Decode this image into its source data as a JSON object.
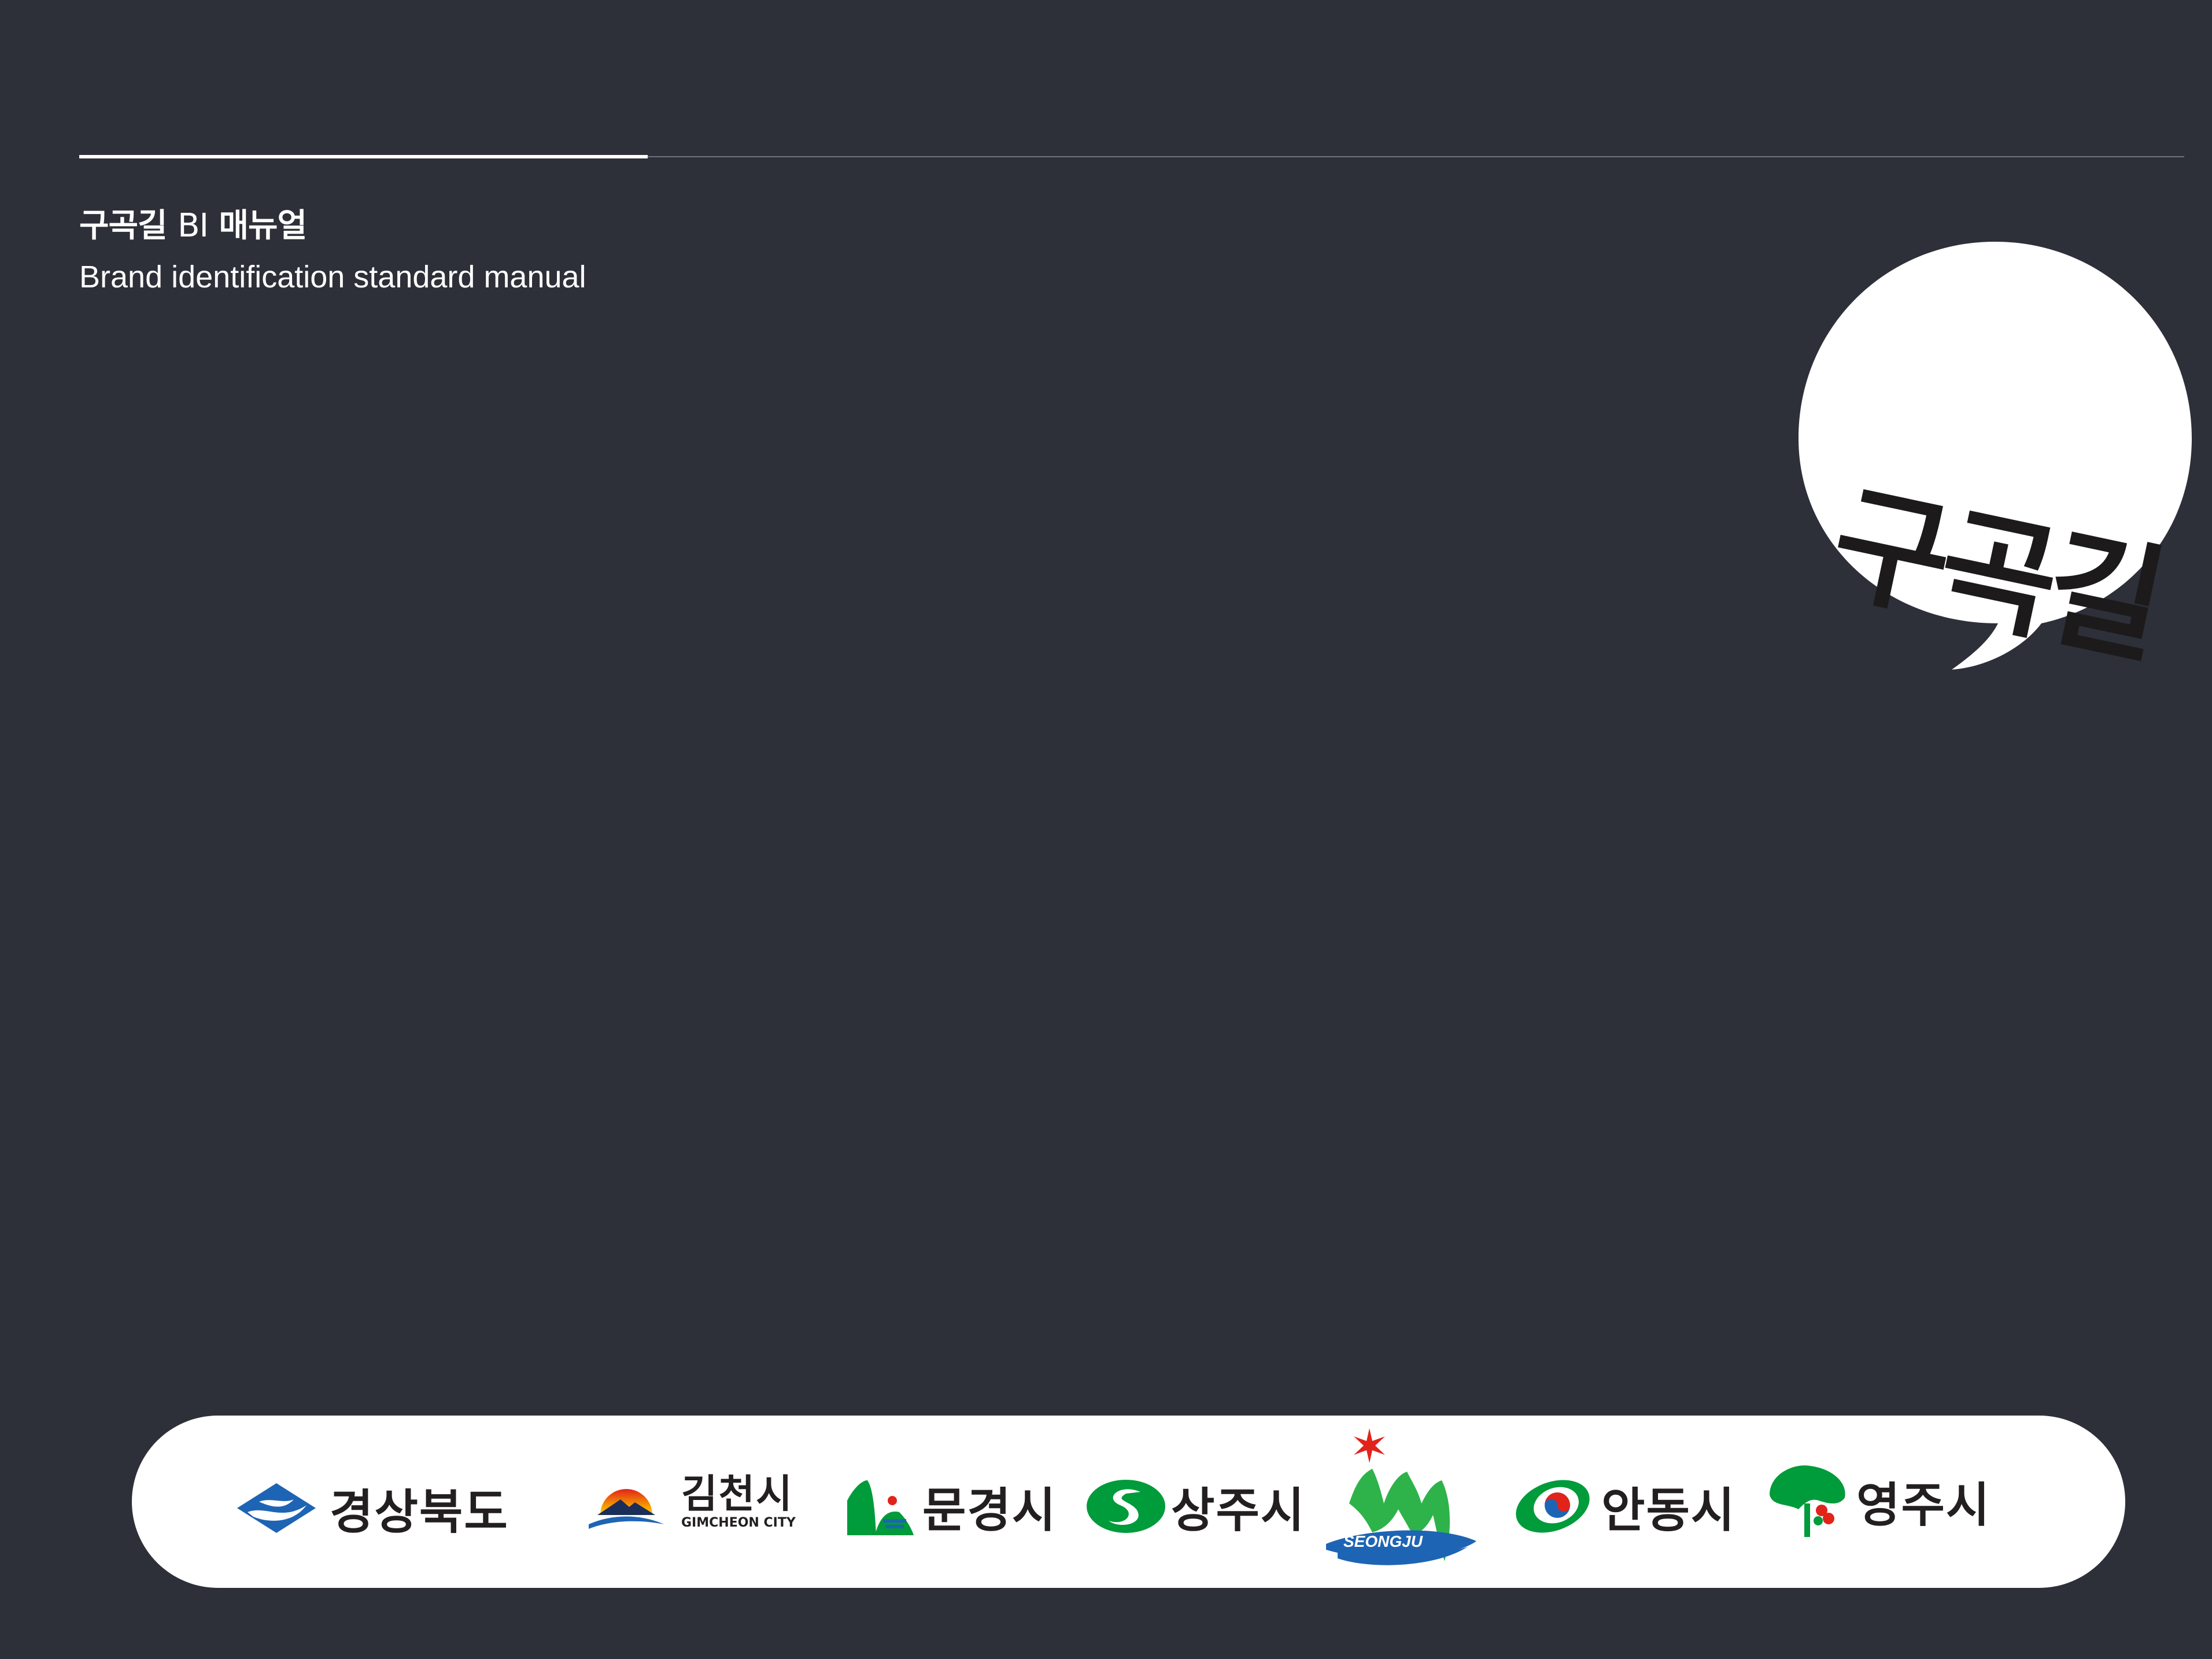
{
  "header": {
    "title_pre": "구곡길 ",
    "title_bi": "BI",
    "title_post": " 매뉴얼",
    "subtitle": "Brand identification standard manual"
  },
  "brand": {
    "name": "구곡길"
  },
  "logos": {
    "gyeongbuk": "경상북도",
    "gimcheon": "김천시",
    "gimcheon_en": "GIMCHEON CITY",
    "mungyeong": "문경시",
    "sangju": "상주시",
    "seongju_en": "SEONGJU",
    "andong": "안동시",
    "yeongju": "영주시"
  },
  "colors": {
    "background": "#2d3039",
    "bar": "#ffffff",
    "ink": "#231f20"
  }
}
